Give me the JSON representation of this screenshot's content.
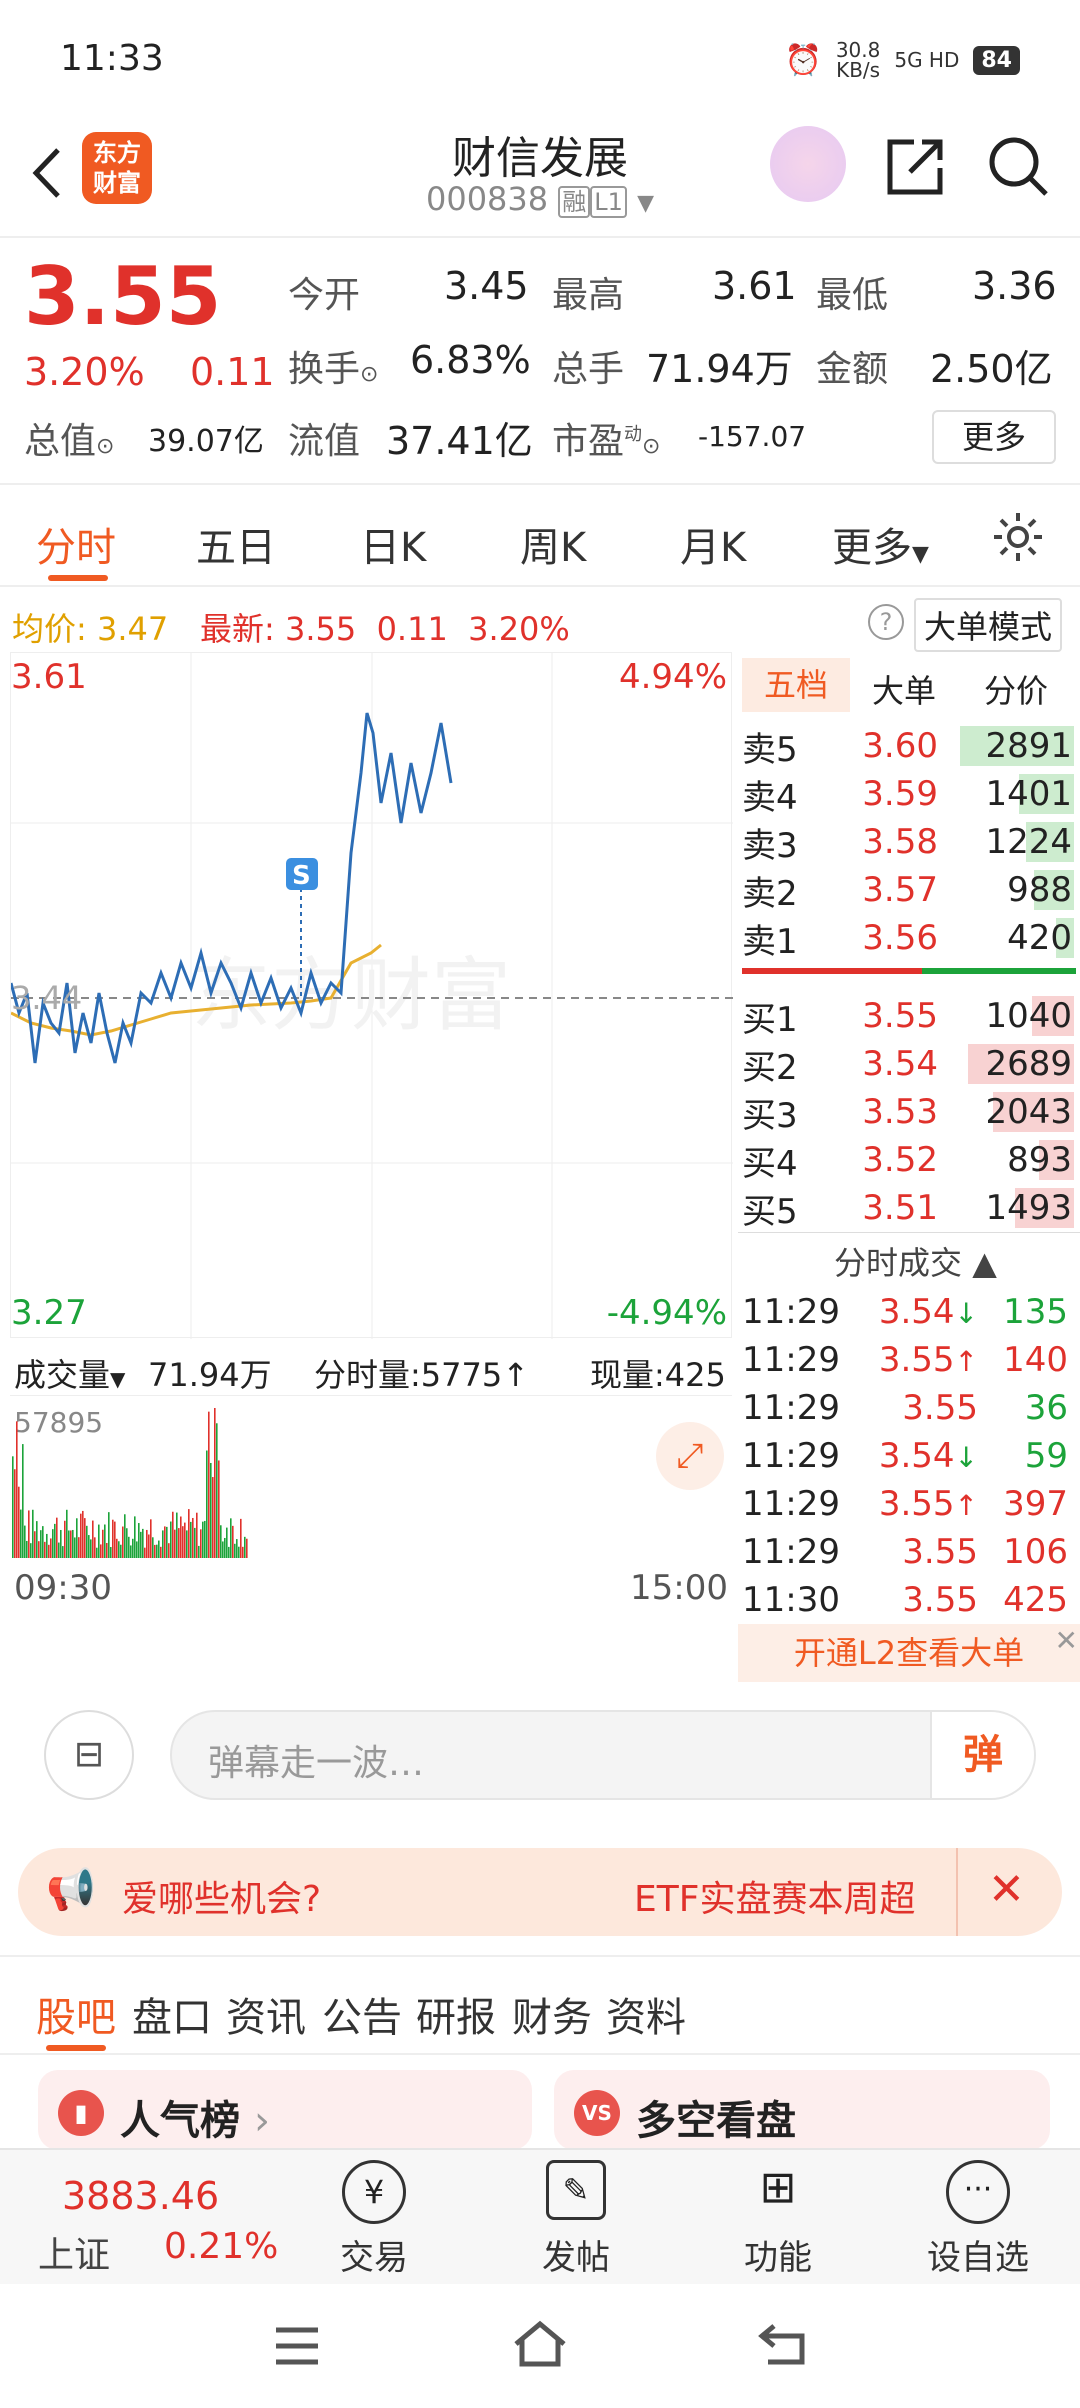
{
  "status": {
    "time": "11:33",
    "speed": "30.8",
    "speed_unit": "KB/s",
    "net": "5G HD",
    "battery": "84"
  },
  "header": {
    "title": "财信发展",
    "code": "000838",
    "tag1": "融",
    "tag2": "L1",
    "logo_l1": "东方",
    "logo_l2": "财富"
  },
  "quote": {
    "price": "3.55",
    "pct": "3.20%",
    "chg": "0.11",
    "open_label": "今开",
    "open": "3.45",
    "high_label": "最高",
    "high": "3.61",
    "low_label": "最低",
    "low": "3.36",
    "turnover_label": "换手",
    "turnover": "6.83%",
    "vol_label": "总手",
    "vol": "71.94万",
    "amt_label": "金额",
    "amt": "2.50亿",
    "mcap_label": "总值",
    "mcap": "39.07亿",
    "float_label": "流值",
    "float": "37.41亿",
    "pe_label": "市盈",
    "pe_sup": "动",
    "pe": "-157.07",
    "more": "更多"
  },
  "tabs": [
    "分时",
    "五日",
    "日K",
    "周K",
    "月K",
    "更多"
  ],
  "avg": {
    "avg_label": "均价:",
    "avg": "3.47",
    "last_label": "最新:",
    "last": "3.55",
    "chg": "0.11",
    "pct": "3.20%",
    "mode": "大单模式"
  },
  "chart": {
    "top_price": "3.61",
    "top_pct": "4.94%",
    "mid_price": "3.44",
    "bot_price": "3.27",
    "bot_pct": "-4.94%",
    "s_marker": "S",
    "watermark": "东方财富"
  },
  "volume": {
    "label": "成交量",
    "total": "71.94万",
    "tick_label": "分时量:5775",
    "now_label": "现量:425",
    "max": "57895",
    "start": "09:30",
    "end": "15:00"
  },
  "orderbook": {
    "tabs": [
      "五档",
      "大单",
      "分价"
    ],
    "asks": [
      {
        "n": "卖5",
        "p": "3.60",
        "v": "2891",
        "w": 0.52
      },
      {
        "n": "卖4",
        "p": "3.59",
        "v": "1401",
        "w": 0.25
      },
      {
        "n": "卖3",
        "p": "3.58",
        "v": "1224",
        "w": 0.22
      },
      {
        "n": "卖2",
        "p": "3.57",
        "v": "988",
        "w": 0.18
      },
      {
        "n": "卖1",
        "p": "3.56",
        "v": "420",
        "w": 0.08
      }
    ],
    "bids": [
      {
        "n": "买1",
        "p": "3.55",
        "v": "1040",
        "w": 0.19
      },
      {
        "n": "买2",
        "p": "3.54",
        "v": "2689",
        "w": 0.48
      },
      {
        "n": "买3",
        "p": "3.53",
        "v": "2043",
        "w": 0.37
      },
      {
        "n": "买4",
        "p": "3.52",
        "v": "893",
        "w": 0.16
      },
      {
        "n": "买5",
        "p": "3.51",
        "v": "1493",
        "w": 0.27
      }
    ],
    "trades_title": "分时成交",
    "trades": [
      {
        "t": "11:29",
        "p": "3.54",
        "d": "↓",
        "v": "135",
        "c": "green"
      },
      {
        "t": "11:29",
        "p": "3.55",
        "d": "↑",
        "v": "140",
        "c": "red"
      },
      {
        "t": "11:29",
        "p": "3.55",
        "d": "",
        "v": "36",
        "c": "green"
      },
      {
        "t": "11:29",
        "p": "3.54",
        "d": "↓",
        "v": "59",
        "c": "green"
      },
      {
        "t": "11:29",
        "p": "3.55",
        "d": "↑",
        "v": "397",
        "c": "red"
      },
      {
        "t": "11:29",
        "p": "3.55",
        "d": "",
        "v": "106",
        "c": "red"
      },
      {
        "t": "11:30",
        "p": "3.55",
        "d": "",
        "v": "425",
        "c": "red"
      }
    ],
    "l2": "开通L2查看大单"
  },
  "danmu": {
    "placeholder": "弹幕走一波…",
    "btn": "弹"
  },
  "banner": {
    "left": "爱哪些机会?",
    "right": "ETF实盘赛本周超"
  },
  "tabs2": [
    "股吧",
    "盘口",
    "资讯",
    "公告",
    "研报",
    "财务",
    "资料"
  ],
  "cards": {
    "c1": "人气榜",
    "c2": "多空看盘"
  },
  "bottom": {
    "index_val": "3883.46",
    "index_name": "上证",
    "index_pct": "0.21%",
    "trade": "交易",
    "post": "发帖",
    "func": "功能",
    "watch": "设自选"
  }
}
